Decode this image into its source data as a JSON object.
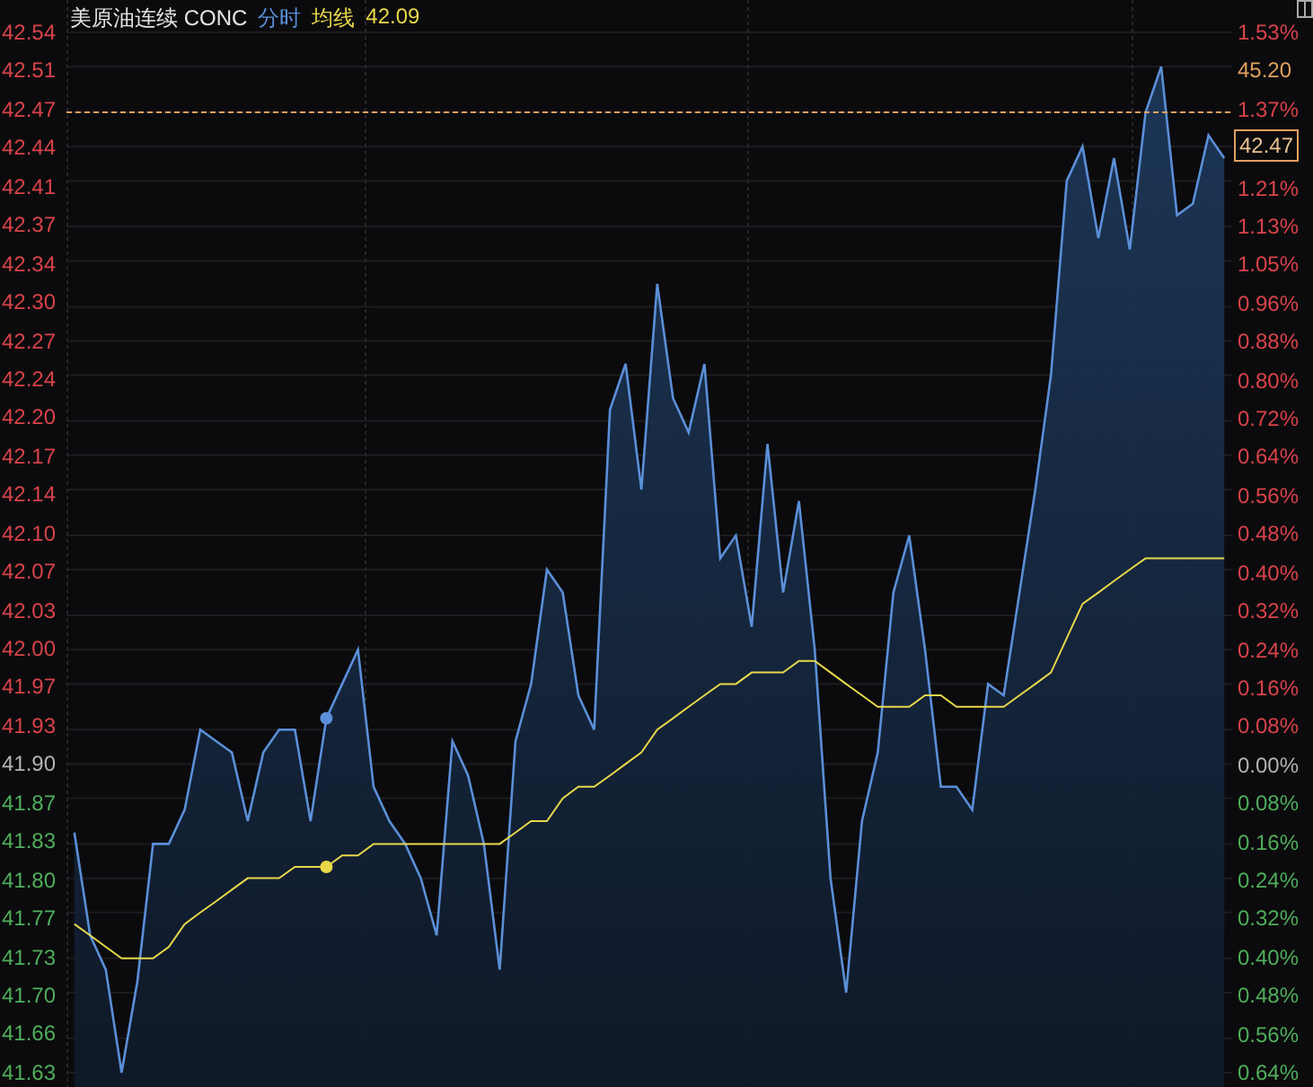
{
  "title": "美原油连续 CONC",
  "average_value": "42.09",
  "left_axis": [
    {
      "color": "#d9434a"
    },
    {
      "color": "#d9434a"
    },
    {
      "color": "#d9434a"
    },
    {
      "color": "#d9434a"
    },
    {
      "color": "#d9434a"
    },
    {
      "color": "#d9434a"
    },
    {
      "color": "#d9434a"
    },
    {
      "color": "#d9434a"
    },
    {
      "color": "#d9434a"
    },
    {
      "color": "#d9434a"
    },
    {
      "color": "#d9434a"
    },
    {
      "color": "#d9434a"
    },
    {
      "color": "#d9434a"
    },
    {
      "color": "#d9434a"
    },
    {
      "color": "#d9434a"
    },
    {
      "color": "#d9434a"
    },
    {
      "color": "#d9434a"
    },
    {
      "color": "#d9434a"
    },
    {
      "color": "#d9434a"
    },
    {
      "color": "#b4b4b4"
    },
    {
      "color": "#4fae5a"
    },
    {
      "color": "#4fae5a"
    },
    {
      "color": "#4fae5a"
    },
    {
      "color": "#4fae5a"
    },
    {
      "color": "#4fae5a"
    },
    {
      "color": "#4fae5a"
    },
    {
      "color": "#4fae5a"
    },
    {
      "color": "#4fae5a"
    }
  ],
  "right_axis": [
    {
      "text": "1.53%",
      "color": "#d9434a"
    },
    {
      "text": "45.20",
      "color": "#e0a060"
    },
    {
      "text": "1.37%",
      "color": "#d9434a"
    },
    {
      "text": "1.21%",
      "color": "#d9434a"
    },
    {
      "text": "1.13%",
      "color": "#d9434a"
    },
    {
      "text": "1.05%",
      "color": "#d9434a"
    },
    {
      "text": "0.96%",
      "color": "#d9434a"
    },
    {
      "text": "0.88%",
      "color": "#d9434a"
    },
    {
      "text": "0.80%",
      "color": "#d9434a"
    },
    {
      "text": "0.72%",
      "color": "#d9434a"
    },
    {
      "text": "0.64%",
      "color": "#d9434a"
    },
    {
      "text": "0.56%",
      "color": "#d9434a"
    },
    {
      "text": "0.48%",
      "color": "#d9434a"
    },
    {
      "text": "0.40%",
      "color": "#d9434a"
    },
    {
      "text": "0.32%",
      "color": "#d9434a"
    },
    {
      "text": "0.24%",
      "color": "#d9434a"
    },
    {
      "text": "0.16%",
      "color": "#d9434a"
    },
    {
      "text": "0.08%",
      "color": "#d9434a"
    },
    {
      "text": "0.00%",
      "color": "#b4b4b4"
    },
    {
      "text": "0.08%",
      "color": "#4fae5a"
    },
    {
      "text": "0.16%",
      "color": "#4fae5a"
    },
    {
      "text": "0.24%",
      "color": "#4fae5a"
    },
    {
      "text": "0.32%",
      "color": "#4fae5a"
    },
    {
      "text": "0.40%",
      "color": "#4fae5a"
    },
    {
      "text": "0.48%",
      "color": "#4fae5a"
    },
    {
      "text": "0.56%",
      "color": "#4fae5a"
    },
    {
      "text": "0.64%",
      "color": "#4fae5a"
    }
  ],
  "chart_data": {
    "type": "area",
    "grid": true,
    "ylim": [
      41.63,
      42.54
    ],
    "yticks": [
      {
        "value": 42.54,
        "label": "42.54"
      },
      {
        "value": 42.51,
        "label": "42.51"
      },
      {
        "value": 42.47,
        "label": "42.47"
      },
      {
        "value": 42.44,
        "label": "42.44"
      },
      {
        "value": 42.41,
        "label": "42.41"
      },
      {
        "value": 42.37,
        "label": "42.37"
      },
      {
        "value": 42.34,
        "label": "42.34"
      },
      {
        "value": 42.3,
        "label": "42.30"
      },
      {
        "value": 42.27,
        "label": "42.27"
      },
      {
        "value": 42.24,
        "label": "42.24"
      },
      {
        "value": 42.2,
        "label": "42.20"
      },
      {
        "value": 42.17,
        "label": "42.17"
      },
      {
        "value": 42.14,
        "label": "42.14"
      },
      {
        "value": 42.1,
        "label": "42.10"
      },
      {
        "value": 42.07,
        "label": "42.07"
      },
      {
        "value": 42.03,
        "label": "42.03"
      },
      {
        "value": 42.0,
        "label": "42.00"
      },
      {
        "value": 41.97,
        "label": "41.97"
      },
      {
        "value": 41.93,
        "label": "41.93"
      },
      {
        "value": 41.9,
        "label": "41.90"
      },
      {
        "value": 41.87,
        "label": "41.87"
      },
      {
        "value": 41.83,
        "label": "41.83"
      },
      {
        "value": 41.8,
        "label": "41.80"
      },
      {
        "value": 41.77,
        "label": "41.77"
      },
      {
        "value": 41.73,
        "label": "41.73"
      },
      {
        "value": 41.7,
        "label": "41.70"
      },
      {
        "value": 41.66,
        "label": "41.66"
      },
      {
        "value": 41.63,
        "label": "41.63"
      }
    ],
    "categories": [
      null,
      null,
      null,
      null,
      null,
      null,
      null,
      null,
      null,
      null,
      null,
      null,
      null,
      null,
      null,
      null,
      null,
      null,
      null,
      null,
      null,
      null,
      null,
      null,
      null,
      null,
      null,
      null,
      null,
      null,
      null,
      null,
      null,
      null,
      null,
      null,
      null,
      null,
      null,
      null,
      null,
      null,
      null,
      null,
      null,
      null,
      null,
      null,
      null,
      null,
      null,
      null,
      null,
      null,
      null,
      null,
      null,
      null,
      null,
      null,
      null,
      null,
      null,
      null,
      null,
      null,
      null,
      null,
      null,
      null,
      null,
      null,
      null,
      null
    ],
    "series": [
      {
        "name": "分时",
        "type": "area",
        "color": "#5b8fd8",
        "values": [
          41.84,
          41.75,
          41.72,
          41.63,
          41.71,
          41.83,
          41.83,
          41.86,
          41.93,
          41.92,
          41.91,
          41.85,
          41.91,
          41.93,
          41.93,
          41.85,
          41.94,
          41.97,
          42.0,
          41.88,
          41.85,
          41.83,
          41.8,
          41.75,
          41.92,
          41.89,
          41.83,
          41.72,
          41.92,
          41.97,
          42.07,
          42.05,
          41.96,
          41.93,
          42.21,
          42.25,
          42.14,
          42.32,
          42.22,
          42.19,
          42.25,
          42.08,
          42.1,
          42.02,
          42.18,
          42.05,
          42.13,
          42.0,
          41.8,
          41.7,
          41.85,
          41.91,
          42.05,
          42.1,
          42.0,
          41.88,
          41.88,
          41.86,
          41.97,
          41.96,
          42.05,
          42.14,
          42.24,
          42.41,
          42.44,
          42.36,
          42.43,
          42.35,
          42.47,
          42.51,
          42.38,
          42.39,
          42.45,
          42.43
        ]
      },
      {
        "name": "均线",
        "type": "line",
        "color": "#e8d84a",
        "values": [
          41.76,
          41.75,
          41.74,
          41.73,
          41.73,
          41.73,
          41.74,
          41.76,
          41.77,
          41.78,
          41.79,
          41.8,
          41.8,
          41.8,
          41.81,
          41.81,
          41.81,
          41.82,
          41.82,
          41.83,
          41.83,
          41.83,
          41.83,
          41.83,
          41.83,
          41.83,
          41.83,
          41.83,
          41.84,
          41.85,
          41.85,
          41.87,
          41.88,
          41.88,
          41.89,
          41.9,
          41.91,
          41.93,
          41.94,
          41.95,
          41.96,
          41.97,
          41.97,
          41.98,
          41.98,
          41.98,
          41.99,
          41.99,
          41.98,
          41.97,
          41.96,
          41.95,
          41.95,
          41.95,
          41.96,
          41.96,
          41.95,
          41.95,
          41.95,
          41.95,
          41.96,
          41.97,
          41.98,
          42.01,
          42.04,
          42.05,
          42.06,
          42.07,
          42.08,
          42.08,
          42.08,
          42.08,
          42.08,
          42.08
        ]
      }
    ],
    "ref_lines": [
      {
        "axis": "y",
        "value": 42.47,
        "label": "42.47"
      }
    ]
  }
}
